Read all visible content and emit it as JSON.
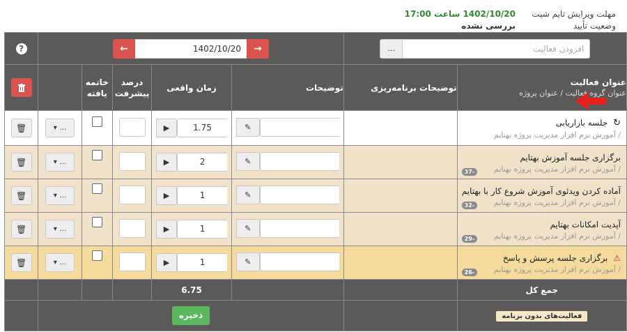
{
  "topinfo": {
    "deadline_label": "مهلت ویرایش تایم شیت",
    "status_label": "وضعیت تأیید",
    "deadline_value": "1402/10/20 ساعت 17:00",
    "status_value": "بررسی نشده"
  },
  "toolbar": {
    "add_activity_placeholder": "افزودن فعالیت",
    "more": "...",
    "date": "1402/10/20",
    "help": "?"
  },
  "headers": {
    "activity_title": "عنوان فعالیت",
    "activity_sub": "عنوان گروه فعالیت  /  عنوان پروژه",
    "planning_desc": "توضیحات برنامه‌ریزی",
    "desc": "توضیحات",
    "actual_time": "زمان واقعی",
    "progress": "درصد پیشرفت",
    "finished": "خاتمه یافته"
  },
  "rows": [
    {
      "title": "جلسه بازاریابی",
      "sub": "/ آموزش نرم افزار مدیریت پروژه بهتایم",
      "time": "1.75",
      "badge": ""
    },
    {
      "title": "برگزاری جلسه آموزش بهتایم",
      "sub": "/ آموزش نرم افزار مدیریت پروژه بهتایم",
      "time": "2",
      "badge": "-37"
    },
    {
      "title": "آماده کردن ویدئوی آموزش شروع کار با بهتایم",
      "sub": "/ آموزش نرم افزار مدیریت پروژه بهتایم",
      "time": "1",
      "badge": "-32"
    },
    {
      "title": "آپدیت امکانات بهتایم",
      "sub": "/ آموزش نرم افزار مدیریت پروژه بهتایم",
      "time": "1",
      "badge": "-29"
    },
    {
      "title": "برگزاری جلسه پرسش و پاسخ",
      "sub": "/ آموزش نرم افزار مدیریت پروژه بهتایم",
      "time": "1",
      "badge": "-26"
    }
  ],
  "footer": {
    "total_label": "جمع کل",
    "total_value": "6.75",
    "save_label": "ذخیره",
    "unplanned_label": "فعالیت‌های بدون برنامه"
  },
  "colors": {
    "dark": "#5c5a59",
    "red": "#d9534f",
    "green": "#5cb85c",
    "tan": "#f0e3c9",
    "yellow": "#f6dc9c"
  }
}
